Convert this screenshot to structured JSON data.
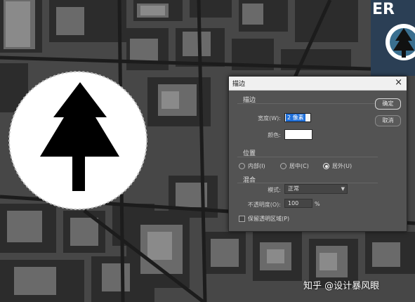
{
  "dialog": {
    "title": "描边",
    "close_glyph": "×",
    "stroke_section": {
      "label": "描边",
      "size_label": "宽度(W):",
      "size_value": "2 像素",
      "color_label": "颜色:",
      "color_value": "#ffffff"
    },
    "position_section": {
      "label": "位置",
      "options": [
        {
          "label": "内部(I)",
          "selected": false
        },
        {
          "label": "居中(C)",
          "selected": false
        },
        {
          "label": "居外(U)",
          "selected": true
        }
      ]
    },
    "blend_section": {
      "label": "混合",
      "mode_label": "模式:",
      "mode_value": "正常",
      "opacity_label": "不透明度(O):",
      "opacity_value": "100",
      "opacity_unit": "%",
      "preserve_label": "保留透明区域(P)",
      "preserve_checked": false
    },
    "buttons": {
      "ok": "确定",
      "cancel": "取消"
    }
  },
  "watermark": "知乎 @设计暴风眼",
  "colors": {
    "dialog_bg": "#535353",
    "titlebar_bg": "#f0f0f0",
    "selection": "#1f6fd9"
  }
}
